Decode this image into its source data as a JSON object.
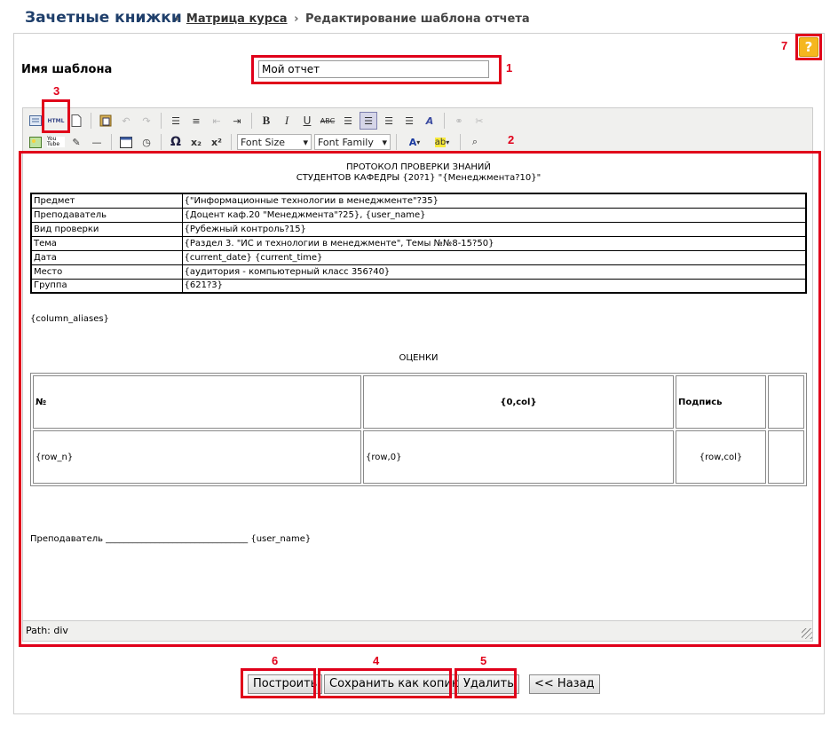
{
  "header": {
    "title": "Зачетные книжки",
    "breadcrumb": {
      "separator": "›",
      "link": "Матрица курса",
      "current": "Редактирование шаблона отчета"
    }
  },
  "form": {
    "name_label": "Имя шаблона",
    "name_value": "Мой отчет"
  },
  "toolbar": {
    "font_size": "Font Size",
    "font_family": "Font Family",
    "html_label": "HTML",
    "youtube_label": "You Tube"
  },
  "document": {
    "heading_line1": "ПРОТОКОЛ ПРОВЕРКИ ЗНАНИЙ",
    "heading_line2": "СТУДЕНТОВ КАФЕДРЫ {20?1} \"{Менеджмента?10}\"",
    "info_rows": [
      {
        "key": "Предмет",
        "value": "{\"Информационные технологии в менеджменте\"?35}"
      },
      {
        "key": "Преподаватель",
        "value": "{Доцент каф.20 \"Менеджмента\"?25}, {user_name}"
      },
      {
        "key": "Вид проверки",
        "value": "{Рубежный контроль?15}"
      },
      {
        "key": "Тема",
        "value": "{Раздел 3. \"ИС и технологии в менеджменте\", Темы №№8-15?50}"
      },
      {
        "key": "Дата",
        "value": "{current_date} {current_time}"
      },
      {
        "key": "Место",
        "value": "{аудитория - компьютерный класс 356?40}"
      },
      {
        "key": "Группа",
        "value": "{621?3}"
      }
    ],
    "aliases": "{column_aliases}",
    "grades_title": "ОЦЕНКИ",
    "grades_header": [
      "№",
      "{0,col}",
      "Подпись",
      ""
    ],
    "grades_row": [
      "{row_n}",
      "{row,0}",
      "{row,col}",
      ""
    ],
    "teacher_line": "Преподаватель ________________________________  {user_name}"
  },
  "status": {
    "path": "Path: div"
  },
  "buttons": {
    "build": "Построить",
    "save_copy": "Сохранить как копию",
    "delete": "Удалить",
    "back": "<< Назад"
  },
  "help": "?",
  "annotations": {
    "n1": "1",
    "n2": "2",
    "n3": "3",
    "n4": "4",
    "n5": "5",
    "n6": "6",
    "n7": "7"
  },
  "colors": {
    "title": "#1f3f6b",
    "annotation": "#e0001a",
    "help_button": "#f5b71f",
    "toolbar_bg": "#f0f0ee"
  }
}
